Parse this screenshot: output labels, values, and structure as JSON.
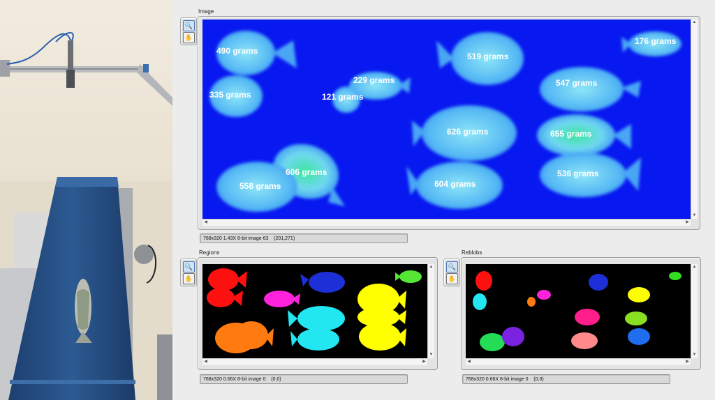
{
  "panels": {
    "image": {
      "label": "Image",
      "status": "768x320 1.43X 8-bit image 63    (201,271)",
      "weights": [
        "490 grams",
        "335 grams",
        "229 grams",
        "121 grams",
        "519 grams",
        "176 grams",
        "547 grams",
        "626 grams",
        "655 grams",
        "606 grams",
        "558 grams",
        "604 grams",
        "536 grams"
      ]
    },
    "regions": {
      "label": "Regions",
      "status": "768x320 0.66X 8-bit image 0    (0,0)"
    },
    "reblobs": {
      "label": "Reblobs",
      "status": "768x320 0.66X 8-bit image 0    (0,0)"
    }
  },
  "colors": {
    "image_background": "#0818f0",
    "fish_fill": "#66ccf4",
    "viewport_black": "#000000"
  },
  "icons": {
    "zoom_tool": "magnifier-icon",
    "pan_tool": "hand-icon",
    "scroll_up": "arrow-up-icon",
    "scroll_down": "arrow-down-icon",
    "scroll_left": "arrow-left-icon",
    "scroll_right": "arrow-right-icon"
  }
}
